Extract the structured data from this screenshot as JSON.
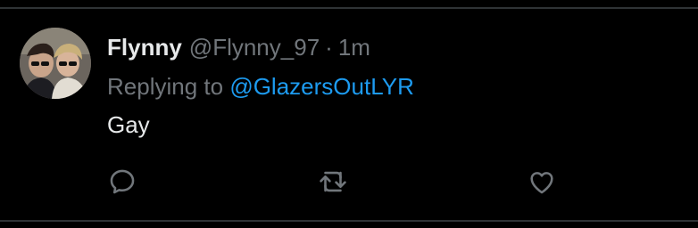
{
  "tweet": {
    "display_name": "Flynny",
    "handle": "@Flynny_97",
    "separator": "·",
    "timestamp": "1m",
    "replying_to_prefix": "Replying to",
    "replying_to_handle": "@GlazersOutLYR",
    "text": "Gay"
  },
  "actions": {
    "reply_icon": "reply-icon",
    "retweet_icon": "retweet-icon",
    "like_icon": "like-icon"
  },
  "colors": {
    "background": "#000000",
    "primary_text": "#e7e9ea",
    "secondary_text": "#71767b",
    "link": "#1d9bf0",
    "divider": "#2f3336"
  }
}
